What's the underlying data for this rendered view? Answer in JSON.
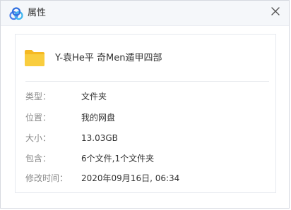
{
  "window": {
    "title": "属性",
    "app_icon": "baidu-netdisk-cloud-icon",
    "close_icon": "close-icon"
  },
  "file": {
    "icon": "folder-icon",
    "name": "Y-袁He平 奇Men遁甲四部"
  },
  "properties": [
    {
      "label": "类型：",
      "value": "文件夹"
    },
    {
      "label": "位置：",
      "value": "我的网盘"
    },
    {
      "label": "大小：",
      "value": "13.03GB"
    },
    {
      "label": "包含：",
      "value": "6个文件,1个文件夹"
    },
    {
      "label": "修改时间：",
      "value": "2020年09月16日, 06:34"
    }
  ],
  "colors": {
    "accent": "#4a7ee8",
    "folder": "#f7c637",
    "label_text": "#888888",
    "value_text": "#333333"
  }
}
